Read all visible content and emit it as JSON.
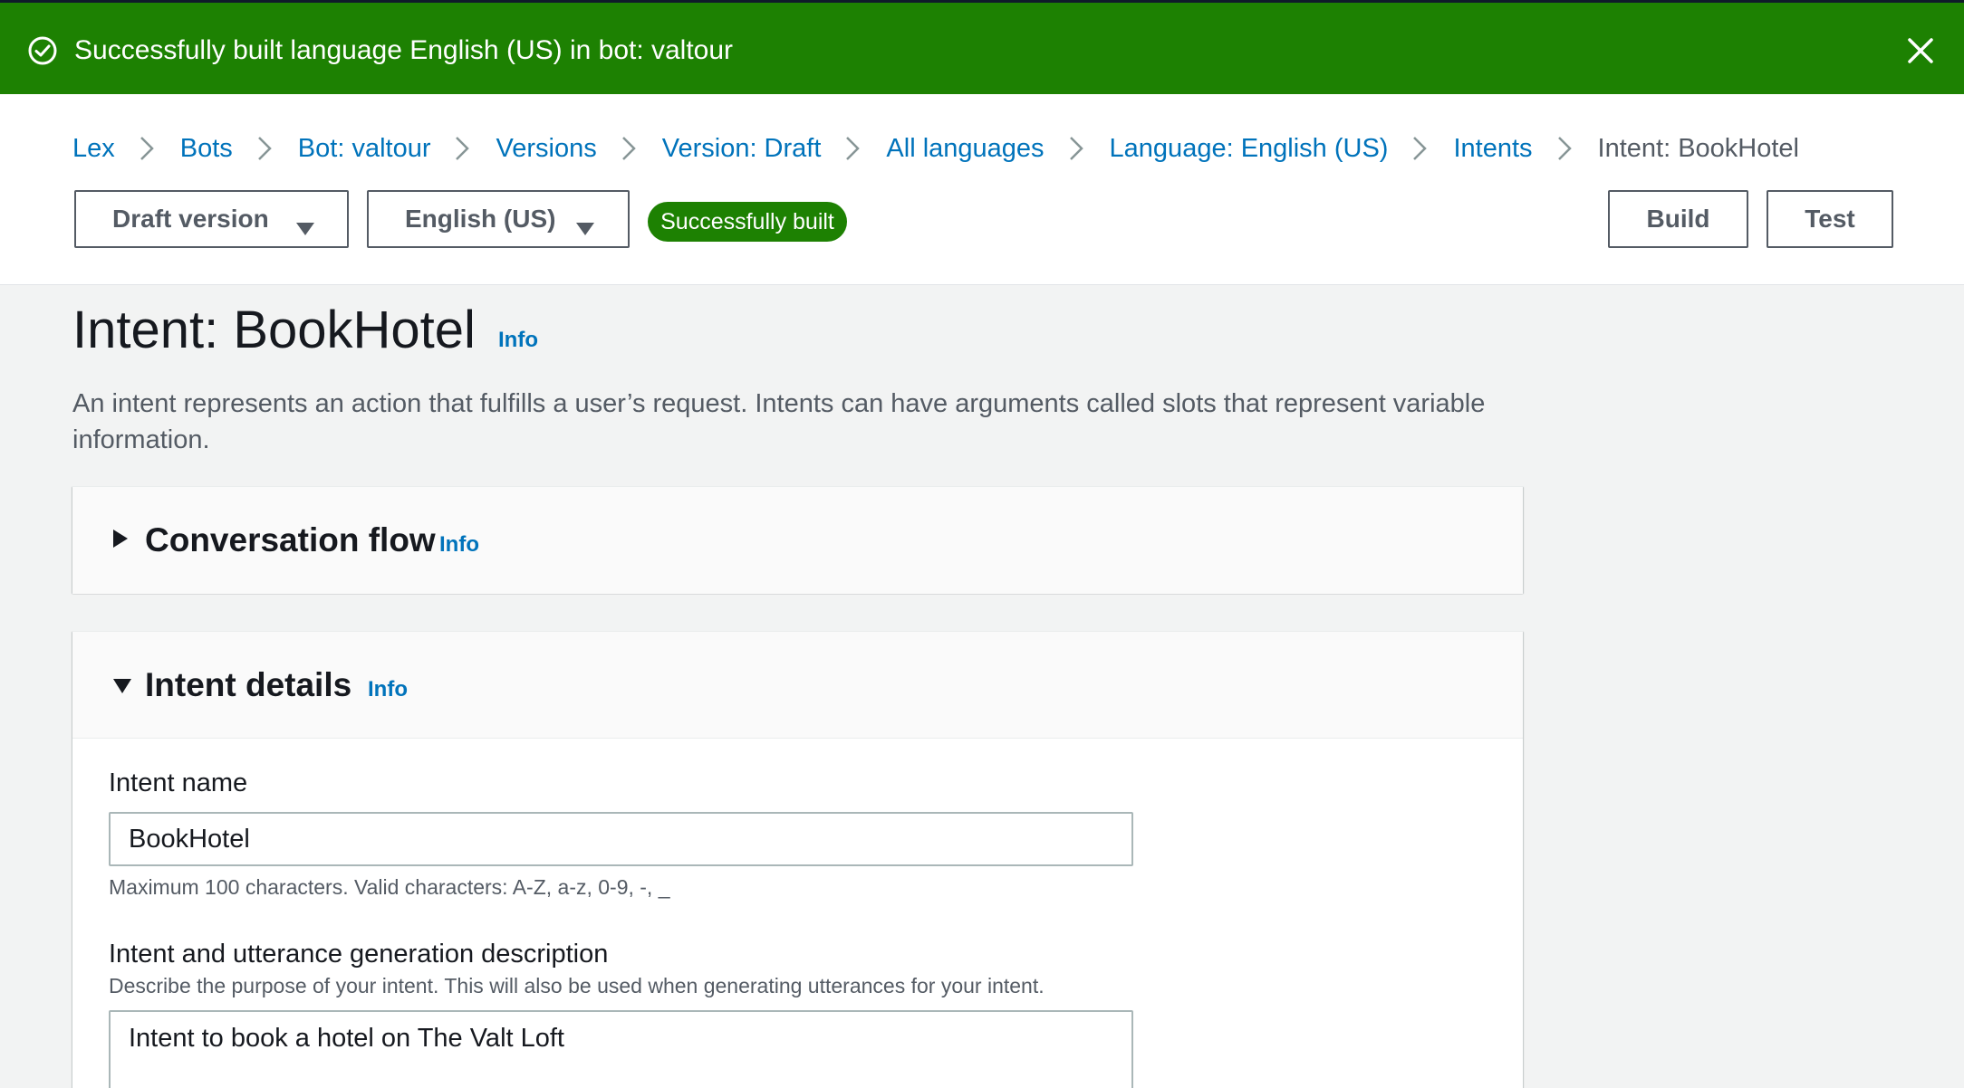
{
  "flash": {
    "message": "Successfully built language English (US) in bot: valtour",
    "status_color": "#1d8102",
    "icon": "check-circle-icon",
    "close_icon": "close-icon"
  },
  "breadcrumbs": {
    "items": [
      {
        "label": "Lex"
      },
      {
        "label": "Bots"
      },
      {
        "label": "Bot: valtour"
      },
      {
        "label": "Versions"
      },
      {
        "label": "Version: Draft"
      },
      {
        "label": "All languages"
      },
      {
        "label": "Language: English (US)"
      },
      {
        "label": "Intents"
      }
    ],
    "current": "Intent: BookHotel",
    "link_color": "#0073bb"
  },
  "toolbar": {
    "version_selector": "Draft version",
    "language_selector": "English (US)",
    "build_status": "Successfully built",
    "build_button": "Build",
    "test_button": "Test"
  },
  "page": {
    "title": "Intent: BookHotel",
    "info": "Info",
    "description": "An intent represents an action that fulfills a user’s request. Intents can have arguments called slots that represent variable information."
  },
  "conversation_flow": {
    "title": "Conversation flow",
    "info": "Info",
    "expanded": false
  },
  "intent_details": {
    "title": "Intent details",
    "info": "Info",
    "expanded": true,
    "name_label": "Intent name",
    "name_value": "BookHotel",
    "name_hint": "Maximum 100 characters. Valid characters: A-Z, a-z, 0-9, -, _",
    "description_label": "Intent and utterance generation description",
    "description_hint": "Describe the purpose of your intent. This will also be used when generating utterances for your intent.",
    "description_value": "Intent to book a hotel on The Valt Loft"
  }
}
